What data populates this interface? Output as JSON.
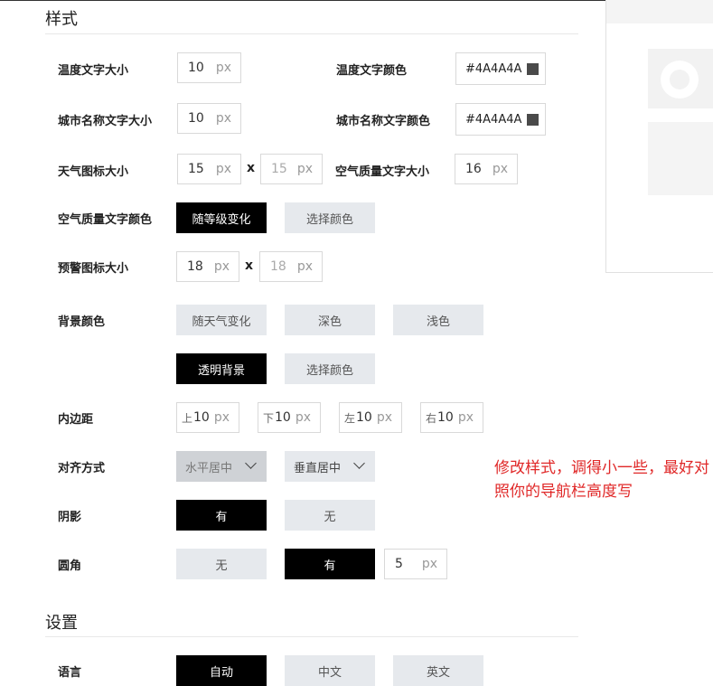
{
  "style_section": {
    "title": "样式",
    "temp_text_size": {
      "label": "温度文字大小",
      "value": "10",
      "unit": "px"
    },
    "temp_text_color": {
      "label": "温度文字颜色",
      "value": "#4A4A4A",
      "swatch": "#4A4A4A"
    },
    "city_text_size": {
      "label": "城市名称文字大小",
      "value": "10",
      "unit": "px"
    },
    "city_text_color": {
      "label": "城市名称文字颜色",
      "value": "#4A4A4A",
      "swatch": "#4A4A4A"
    },
    "weather_icon_size": {
      "label": "天气图标大小",
      "width": "15",
      "height": "15",
      "unit": "px",
      "times": "x"
    },
    "aqi_text_size": {
      "label": "空气质量文字大小",
      "value": "16",
      "unit": "px"
    },
    "aqi_text_color": {
      "label": "空气质量文字颜色",
      "options": [
        "随等级变化",
        "选择颜色"
      ],
      "selected": "随等级变化"
    },
    "alert_icon_size": {
      "label": "预警图标大小",
      "width": "18",
      "height": "18",
      "unit": "px",
      "times": "x"
    },
    "background_color": {
      "label": "背景颜色",
      "options": [
        "随天气变化",
        "深色",
        "浅色",
        "透明背景",
        "选择颜色"
      ],
      "selected": "透明背景"
    },
    "padding": {
      "label": "内边距",
      "top_prefix": "上",
      "top": "10",
      "bottom_prefix": "下",
      "bottom": "10",
      "left_prefix": "左",
      "left": "10",
      "right_prefix": "右",
      "right": "10",
      "unit": "px"
    },
    "alignment": {
      "label": "对齐方式",
      "horizontal": "水平居中",
      "vertical": "垂直居中"
    },
    "shadow": {
      "label": "阴影",
      "options": [
        "有",
        "无"
      ],
      "selected": "有"
    },
    "radius": {
      "label": "圆角",
      "options": [
        "无",
        "有"
      ],
      "selected": "有",
      "value": "5",
      "unit": "px"
    }
  },
  "settings_section": {
    "title": "设置",
    "language": {
      "label": "语言",
      "options": [
        "自动",
        "中文",
        "英文"
      ],
      "selected": "自动"
    }
  },
  "annotation": {
    "text": "修改样式，调得小一些，最好对照你的导航栏高度写",
    "color": "#e02828"
  }
}
